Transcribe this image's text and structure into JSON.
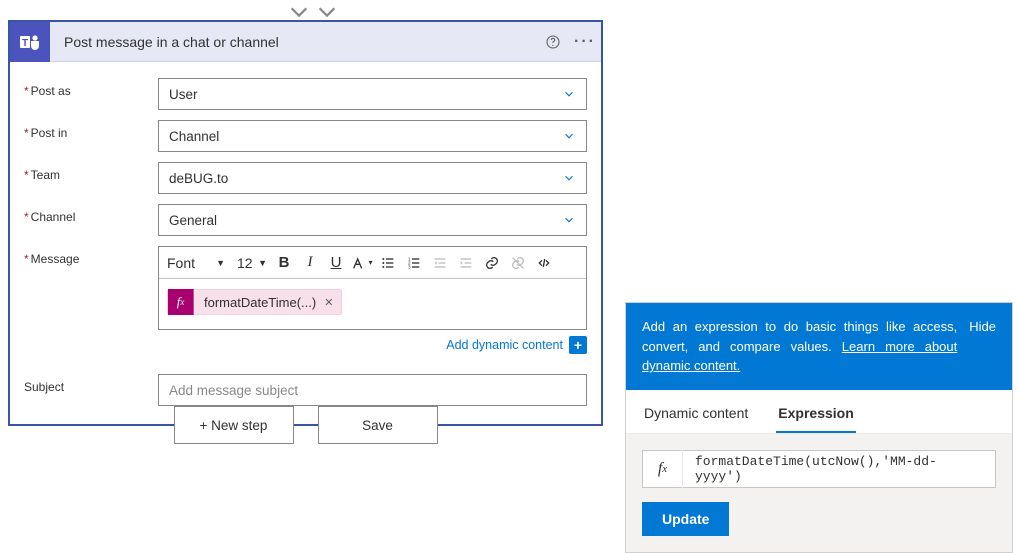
{
  "card": {
    "title": "Post message in a chat or channel",
    "fields": {
      "post_as": {
        "label": "Post as",
        "value": "User"
      },
      "post_in": {
        "label": "Post in",
        "value": "Channel"
      },
      "team": {
        "label": "Team",
        "value": "deBUG.to"
      },
      "channel": {
        "label": "Channel",
        "value": "General"
      },
      "message": {
        "label": "Message"
      },
      "subject": {
        "label": "Subject",
        "placeholder": "Add message subject"
      }
    },
    "rich_text": {
      "font_label": "Font",
      "size_label": "12"
    },
    "token": {
      "label": "formatDateTime(...)"
    },
    "dyn_link": "Add dynamic content"
  },
  "footer": {
    "new_step": "+ New step",
    "save": "Save"
  },
  "panel": {
    "tip": "Add an expression to do basic things like access, convert, and compare values. ",
    "learn_more": "Learn more about dynamic content.",
    "hide": "Hide",
    "tabs": {
      "dynamic": "Dynamic content",
      "expression": "Expression"
    },
    "expression_value": "formatDateTime(utcNow(),'MM-dd-yyyy')",
    "update": "Update"
  }
}
